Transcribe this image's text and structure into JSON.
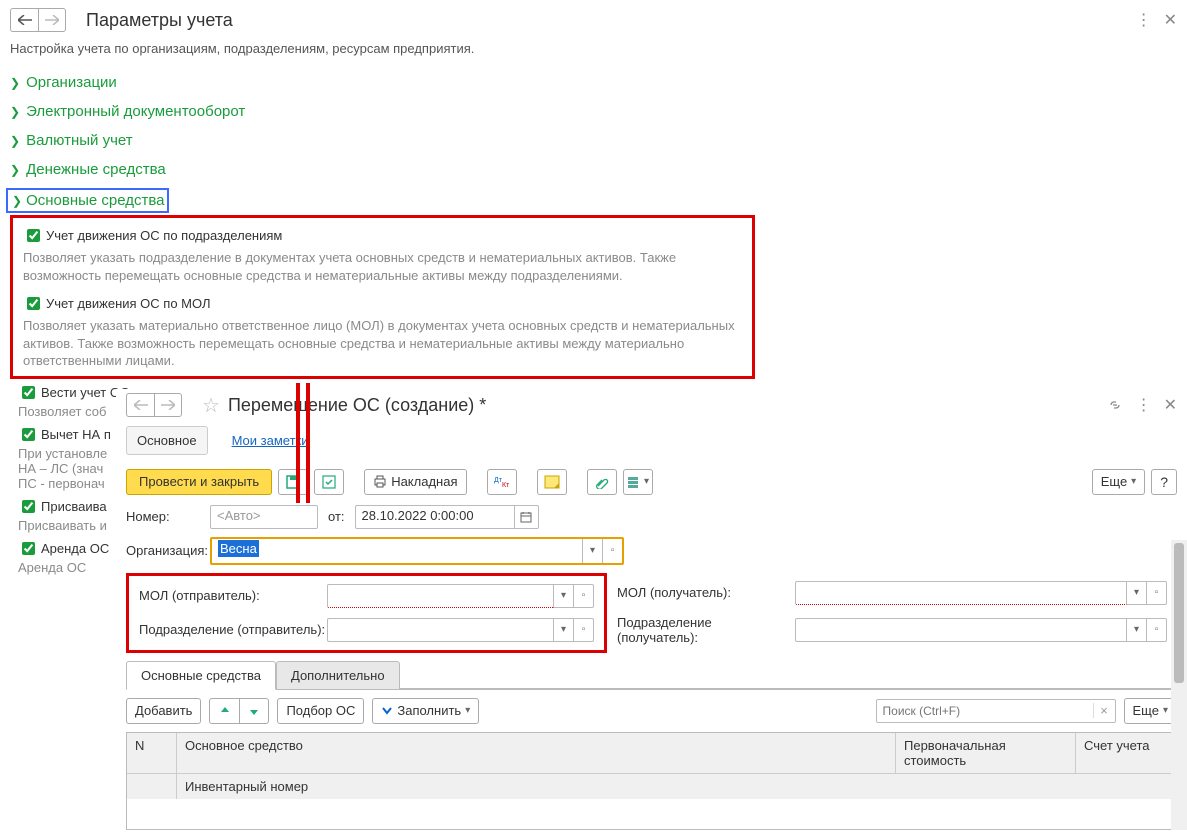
{
  "header": {
    "title": "Параметры учета",
    "description": "Настройка учета по организациям, подразделениям, ресурсам предприятия."
  },
  "sections": [
    {
      "label": "Организации"
    },
    {
      "label": "Электронный документооборот"
    },
    {
      "label": "Валютный учет"
    },
    {
      "label": "Денежные средства"
    }
  ],
  "expanded_section": "Основные средства",
  "os_box": {
    "check1_label": "Учет движения ОС по подразделениям",
    "check1_help": "Позволяет указать подразделение в документах учета основных средств и нематериальных активов. Также возможность перемещать основные средства и нематериальные активы между подразделениями.",
    "check2_label": "Учет движения ОС по МОЛ",
    "check2_help": "Позволяет указать материально ответственное лицо (МОЛ) в документах учета основных средств и нематериальных активов. Также возможность перемещать основные средства и нематериальные активы между материально ответственными лицами."
  },
  "extra_checks": {
    "c1_label": "Вести учет ОС по комплектам",
    "c1_help": "Позволяет соб",
    "c2_label": "Вычет НА п",
    "c2_help": "При установле\nНА – ЛС (знач\nПС - первонач",
    "c3_label": "Присваива",
    "c3_help": "Присваивать и",
    "c4_label": "Аренда ОС",
    "c4_help": "Аренда ОС"
  },
  "inner": {
    "title": "Перемещение ОС (создание) *",
    "tabs": {
      "main": "Основное",
      "notes": "Мои заметки"
    },
    "toolbar": {
      "post_close": "Провести и закрыть",
      "invoice": "Накладная",
      "more": "Еще",
      "fill": "Заполнить"
    },
    "form": {
      "number_label": "Номер:",
      "number_placeholder": "<Авто>",
      "from_label": "от:",
      "date_value": "28.10.2022  0:00:00",
      "org_label": "Организация:",
      "org_value": "Весна",
      "mol_sender": "МОЛ (отправитель):",
      "mol_receiver": "МОЛ (получатель):",
      "dep_sender": "Подразделение (отправитель):",
      "dep_receiver": "Подразделение (получатель):"
    },
    "subtabs": {
      "os": "Основные средства",
      "extra": "Дополнительно"
    },
    "table_toolbar": {
      "add": "Добавить",
      "pick_os": "Подбор ОС",
      "search_placeholder": "Поиск (Ctrl+F)",
      "more": "Еще"
    },
    "table": {
      "col_n": "N",
      "col_os": "Основное средство",
      "col_cost": "Первоначальная стоимость",
      "col_acct": "Счет учета",
      "col_inv": "Инвентарный номер"
    }
  }
}
